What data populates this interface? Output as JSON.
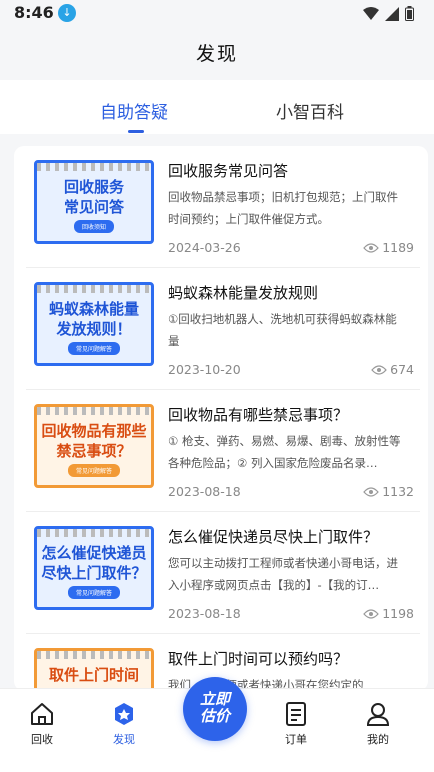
{
  "status": {
    "time": "8:46"
  },
  "header": {
    "title": "发现"
  },
  "tabs": [
    {
      "label": "自助答疑",
      "active": true
    },
    {
      "label": "小智百科",
      "active": false
    }
  ],
  "articles": [
    {
      "thumb_text": "回收服务\n常见问答",
      "thumb_tag": "回收须知",
      "thumb_style": "blue",
      "title": "回收服务常见问答",
      "desc": "回收物品禁忌事项；旧机打包规范；上门取件时间预约；上门取件催促方式。",
      "date": "2024-03-26",
      "views": "1189"
    },
    {
      "thumb_text": "蚂蚁森林能量\n发放规则！",
      "thumb_tag": "常见问题解答",
      "thumb_style": "blue",
      "title": "蚂蚁森林能量发放规则",
      "desc": "①回收扫地机器人、洗地机可获得蚂蚁森林能量",
      "date": "2023-10-20",
      "views": "674"
    },
    {
      "thumb_text": "回收物品有那些\n禁忌事项？",
      "thumb_tag": "常见问题解答",
      "thumb_style": "orange",
      "title": "回收物品有哪些禁忌事项？",
      "desc": "① 枪支、弹药、易燃、易爆、剧毒、放射性等各种危险品；② 列入国家危险废品名录…",
      "date": "2023-08-18",
      "views": "1132"
    },
    {
      "thumb_text": "怎么催促快递员\n尽快上门取件？",
      "thumb_tag": "常见问题解答",
      "thumb_style": "blue",
      "title": "怎么催促快递员尽快上门取件？",
      "desc": "您可以主动拨打工程师或者快递小哥电话，进入小程序或网页点击【我的】-【我的订…",
      "date": "2023-08-18",
      "views": "1198"
    },
    {
      "thumb_text": "取件上门时间",
      "thumb_tag": "",
      "thumb_style": "orange",
      "title": "取件上门时间可以预约吗？",
      "desc": "我们…工程师或者快递小哥在您约定的",
      "date": "",
      "views": ""
    }
  ],
  "nav": {
    "items": [
      {
        "label": "回收",
        "icon": "home-icon",
        "active": false
      },
      {
        "label": "发现",
        "icon": "discover-icon",
        "active": true
      },
      {
        "label": "订单",
        "icon": "order-icon",
        "active": false
      },
      {
        "label": "我的",
        "icon": "profile-icon",
        "active": false
      }
    ],
    "center_label": "立即\n估价"
  },
  "colors": {
    "accent": "#2d5fe0",
    "orange": "#f29a36"
  }
}
